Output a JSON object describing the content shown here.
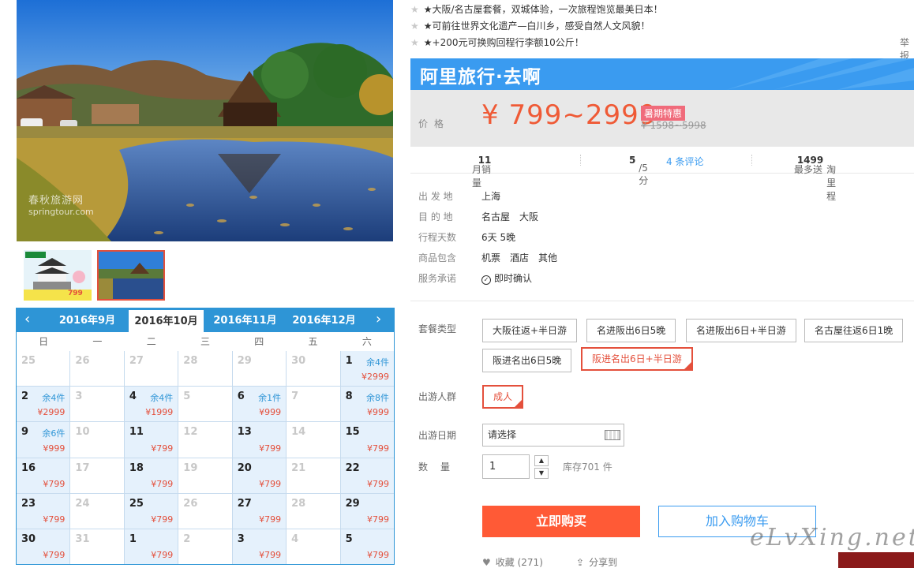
{
  "promos": [
    "★大阪/名古屋套餐，双城体验，一次旅程饱览最美日本！",
    "★可前往世界文化遗产—白川乡，感受自然人文风貌！",
    "★+200元可换购回程行李额10公斤！"
  ],
  "report_label": "举报",
  "watermark": {
    "cn": "春秋旅游网",
    "en": "springtour.com"
  },
  "thumb1_price": "799",
  "calendar": {
    "months": [
      "2016年9月",
      "2016年10月",
      "2016年11月",
      "2016年12月"
    ],
    "active_month": "2016年10月",
    "weekdays": [
      "日",
      "一",
      "二",
      "三",
      "四",
      "五",
      "六"
    ],
    "cells": [
      {
        "d": "25",
        "dim": true
      },
      {
        "d": "26",
        "dim": true
      },
      {
        "d": "27",
        "dim": true
      },
      {
        "d": "28",
        "dim": true
      },
      {
        "d": "29",
        "dim": true
      },
      {
        "d": "30",
        "dim": true
      },
      {
        "d": "1",
        "stock": "余4件",
        "price": "¥2999"
      },
      {
        "d": "2",
        "stock": "余4件",
        "price": "¥2999"
      },
      {
        "d": "3",
        "dim": true
      },
      {
        "d": "4",
        "stock": "余4件",
        "price": "¥1999"
      },
      {
        "d": "5",
        "dim": true
      },
      {
        "d": "6",
        "stock": "余1件",
        "price": "¥999"
      },
      {
        "d": "7",
        "dim": true
      },
      {
        "d": "8",
        "stock": "余8件",
        "price": "¥999"
      },
      {
        "d": "9",
        "stock": "余6件",
        "price": "¥999"
      },
      {
        "d": "10",
        "dim": true
      },
      {
        "d": "11",
        "price": "¥799"
      },
      {
        "d": "12",
        "dim": true
      },
      {
        "d": "13",
        "price": "¥799"
      },
      {
        "d": "14",
        "dim": true
      },
      {
        "d": "15",
        "price": "¥799"
      },
      {
        "d": "16",
        "price": "¥799"
      },
      {
        "d": "17",
        "dim": true
      },
      {
        "d": "18",
        "price": "¥799"
      },
      {
        "d": "19",
        "dim": true
      },
      {
        "d": "20",
        "price": "¥799"
      },
      {
        "d": "21",
        "dim": true
      },
      {
        "d": "22",
        "price": "¥799"
      },
      {
        "d": "23",
        "price": "¥799"
      },
      {
        "d": "24",
        "dim": true
      },
      {
        "d": "25",
        "price": "¥799"
      },
      {
        "d": "26",
        "dim": true
      },
      {
        "d": "27",
        "price": "¥799"
      },
      {
        "d": "28",
        "dim": true
      },
      {
        "d": "29",
        "price": "¥799"
      },
      {
        "d": "30",
        "price": "¥799"
      },
      {
        "d": "31",
        "dim": true
      },
      {
        "d": "1",
        "price": "¥799"
      },
      {
        "d": "2",
        "dim": true
      },
      {
        "d": "3",
        "price": "¥799"
      },
      {
        "d": "4",
        "dim": true
      },
      {
        "d": "5",
        "price": "¥799"
      }
    ]
  },
  "brand": "阿里旅行·去啊",
  "price": {
    "label": "价格",
    "value": "¥ 799~2999",
    "badge": "暑期特惠",
    "original": "¥ 1598~5998"
  },
  "stats": {
    "sales_label": "月销量",
    "sales_value": "11",
    "rating_value": "5",
    "rating_suffix": "/5分",
    "reviews": "4 条评论",
    "points_prefix": "最多送",
    "points_value": "1499",
    "points_suffix": "淘里程"
  },
  "info": [
    {
      "k": "出 发 地",
      "v": "上海"
    },
    {
      "k": "目 的 地",
      "v": "名古屋　大阪"
    },
    {
      "k": "行程天数",
      "v": "6天 5晚"
    },
    {
      "k": "商品包含",
      "v": "机票　酒店　其他"
    },
    {
      "k": "服务承诺",
      "v": "即时确认"
    }
  ],
  "package": {
    "label": "套餐类型",
    "options": [
      "大阪往返+半日游",
      "名进阪出6日5晚",
      "名进阪出6日+半日游",
      "名古屋往返6日1晚",
      "阪进名出6日5晚",
      "阪进名出6日+半日游"
    ],
    "selected": "阪进名出6日+半日游"
  },
  "travelers": {
    "label": "出游人群",
    "option": "成人"
  },
  "date": {
    "label": "出游日期",
    "placeholder": "请选择"
  },
  "quantity": {
    "label": "数　量",
    "value": "1",
    "stock": "库存701 件"
  },
  "buttons": {
    "buy": "立即购买",
    "cart": "加入购物车"
  },
  "favorite": {
    "label": "收藏",
    "count": "(271)"
  },
  "share": "分享到",
  "signature": "eLvXing.net",
  "colors": {
    "accent": "#3a9bf0",
    "price": "#ef5a36",
    "buy": "#ff5a36",
    "selected": "#e4503c"
  }
}
